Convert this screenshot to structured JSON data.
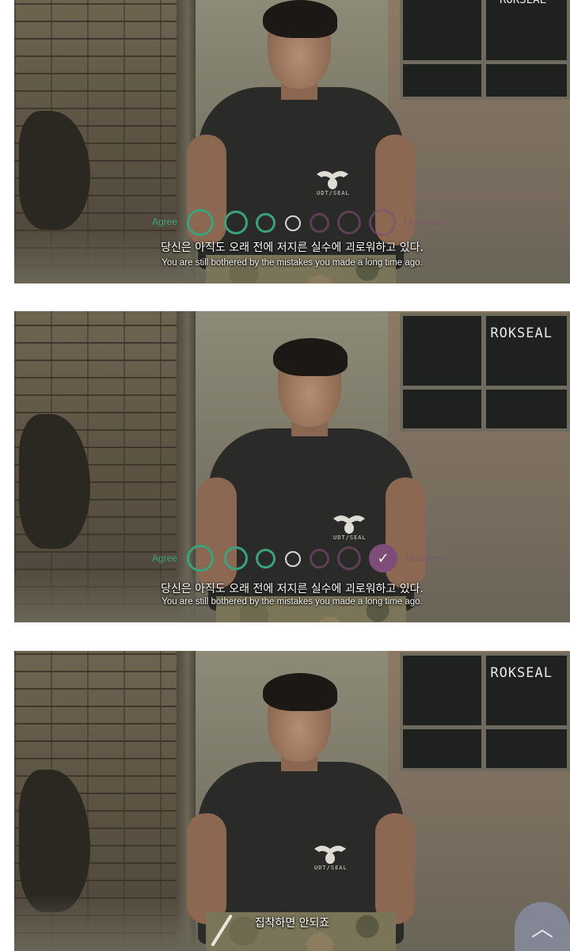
{
  "frames": [
    {
      "top_overlay": "ROKSEAL",
      "scale": {
        "agree_label": "Agree",
        "disagree_label": "Disagree",
        "selected_index": null
      },
      "subtitle_ko": "당신은 아직도 오래 전에 저지른 실수에 괴로워하고 있다.",
      "subtitle_en": "You are still bothered by the mistakes you made a long time ago.",
      "shirt_emblem": "UDT/SEAL"
    },
    {
      "brand": "ROKSEAL",
      "scale": {
        "agree_label": "Agree",
        "disagree_label": "Disagree",
        "selected_index": 6
      },
      "subtitle_ko": "당신은 아직도 오래 전에 저지른 실수에 괴로워하고 있다.",
      "subtitle_en": "You are still bothered by the mistakes you made a long time ago.",
      "shirt_emblem": "UDT/SEAL"
    },
    {
      "brand": "ROKSEAL",
      "subtitle_ko": "집착하면 안되죠",
      "shirt_emblem": "UDT/SEAL"
    }
  ],
  "colors": {
    "agree": "#3aa37d",
    "disagree": "#7e4e78",
    "neutral": "#d7d7d7"
  },
  "icons": {
    "check": "check-icon",
    "scroll_top": "chevron-up-icon"
  }
}
